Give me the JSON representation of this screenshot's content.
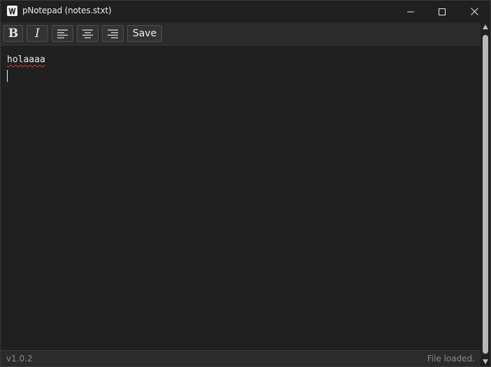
{
  "window": {
    "title": "pNotepad (notes.stxt)",
    "app_icon_letter": "W",
    "controls": {
      "minimize_icon": "minimize-icon",
      "maximize_icon": "maximize-icon",
      "close_icon": "close-icon"
    }
  },
  "toolbar": {
    "bold_glyph": "B",
    "italic_glyph": "I",
    "align_left_icon": "align-left-icon",
    "align_center_icon": "align-center-icon",
    "align_right_icon": "align-right-icon",
    "save_label": "Save"
  },
  "editor": {
    "lines": [
      "holaaaa",
      ""
    ],
    "misspelled_word": "holaaaa",
    "spellcheck_color": "#d83a3a"
  },
  "statusbar": {
    "version": "v1.0.2",
    "message": "File loaded."
  },
  "colors": {
    "background": "#202020",
    "toolbar": "#2b2b2b",
    "text": "#f0f0f0",
    "muted_text": "#8a8a8a"
  }
}
